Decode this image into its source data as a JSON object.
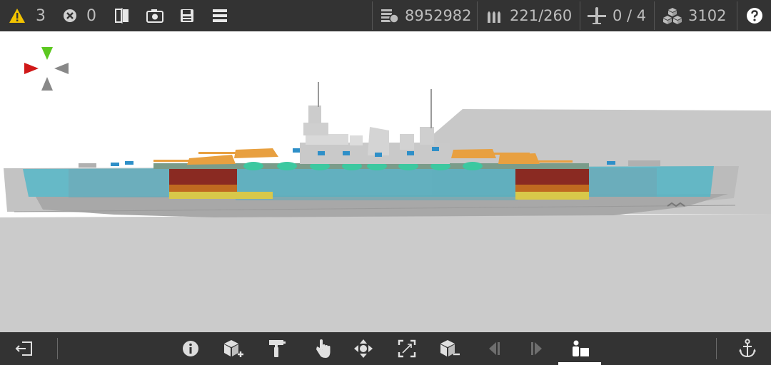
{
  "topbar": {
    "warnings_count": "3",
    "errors_count": "0",
    "cost": "8952982",
    "ammo": "221/260",
    "aircraft": "0 / 4",
    "weight": "3102"
  },
  "icons": {
    "warning": "warning-triangle-icon",
    "error": "error-x-circle-icon",
    "mirror": "mirror-split-icon",
    "camera": "camera-icon",
    "save": "floppy-save-icon",
    "menu": "hamburger-menu-icon",
    "cost": "coin-stack-icon",
    "ammo": "shells-icon",
    "aircraft": "airplane-icon",
    "weight": "crates-icon",
    "help": "help-question-icon",
    "exit": "exit-icon",
    "info": "info-icon",
    "add_part": "add-block-icon",
    "paint": "paint-roller-icon",
    "select": "hand-pointer-icon",
    "move": "move-arrows-icon",
    "resize": "resize-frame-icon",
    "remove_part": "remove-block-icon",
    "undo": "undo-icon",
    "redo": "redo-icon",
    "crew": "crew-seat-icon",
    "anchor": "anchor-icon"
  },
  "colors": {
    "bar_bg": "#333333",
    "accent_green": "#5cc820",
    "accent_red": "#d01818",
    "hull_blue": "#4fb7c8",
    "turret_orange": "#e8a040",
    "warning_yellow": "#f2c300"
  }
}
